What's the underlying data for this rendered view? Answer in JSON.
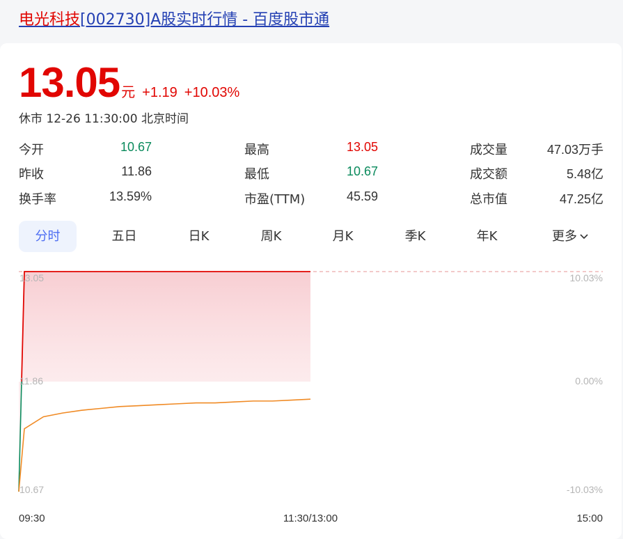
{
  "title": {
    "name": "电光科技",
    "rest": "[002730]A股实时行情 - 百度股市通"
  },
  "quote": {
    "price": "13.05",
    "unit": "元",
    "change": "+1.19",
    "change_pct": "+10.03%",
    "status": "休市 12-26 11:30:00 北京时间"
  },
  "stats": [
    {
      "label": "今开",
      "value": "10.67"
    },
    {
      "label": "最高",
      "value": "13.05"
    },
    {
      "label": "成交量",
      "value": "47.03万手"
    },
    {
      "label": "昨收",
      "value": "11.86"
    },
    {
      "label": "最低",
      "value": "10.67"
    },
    {
      "label": "成交额",
      "value": "5.48亿"
    },
    {
      "label": "换手率",
      "value": "13.59%"
    },
    {
      "label": "市盈(TTM)",
      "value": "45.59"
    },
    {
      "label": "总市值",
      "value": "47.25亿"
    }
  ],
  "tabs": [
    "分时",
    "五日",
    "日K",
    "周K",
    "月K",
    "季K",
    "年K",
    "更多"
  ],
  "colors": {
    "up": "#e10602",
    "down": "#0a8a5c",
    "accent": "#4e6ef2",
    "avg_line": "#f08a24"
  },
  "chart_data": {
    "type": "line",
    "y_left_ticks": [
      "13.05",
      "11.86",
      "10.67"
    ],
    "y_right_ticks": [
      "10.03%",
      "0.00%",
      "-10.03%"
    ],
    "x_ticks": [
      "09:30",
      "11:30/13:00",
      "15:00"
    ],
    "ylim": [
      10.67,
      13.05
    ],
    "prev_close": 11.86,
    "series": [
      {
        "key": "price",
        "values": [
          10.67,
          13.05,
          13.05,
          13.05,
          13.05,
          13.05,
          13.05,
          13.05,
          13.05,
          13.05,
          13.05,
          13.05,
          13.05,
          13.05,
          13.05,
          13.05,
          13.05
        ]
      },
      {
        "key": "average",
        "values": [
          10.67,
          11.35,
          11.48,
          11.52,
          11.55,
          11.57,
          11.59,
          11.6,
          11.61,
          11.62,
          11.63,
          11.63,
          11.64,
          11.65,
          11.65,
          11.66,
          11.67
        ]
      }
    ]
  }
}
